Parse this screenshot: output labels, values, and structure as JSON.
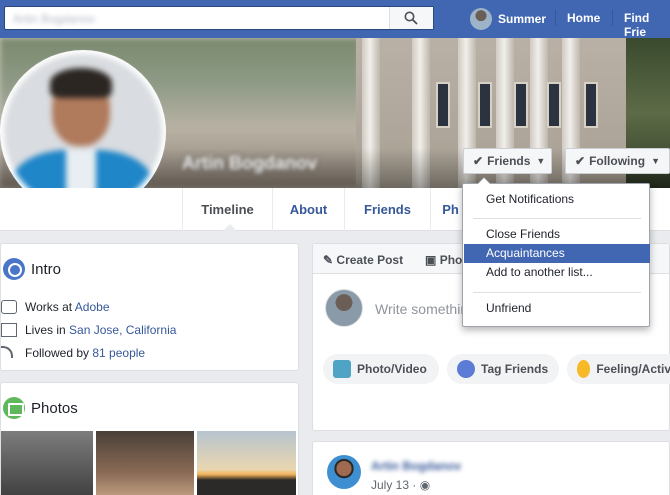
{
  "topbar": {
    "search_placeholder": "Artin Bogdanov",
    "user_name": "Summer",
    "home_label": "Home",
    "find_friends_label": "Find Frie"
  },
  "cover": {
    "profile_name": "Artin Bogdanov",
    "friends_button": "Friends",
    "following_button": "Following"
  },
  "tabs": [
    "Timeline",
    "About",
    "Friends",
    "Ph"
  ],
  "intro": {
    "title": "Intro",
    "works_prefix": "Works at ",
    "works_link": "Adobe",
    "lives_prefix": "Lives in ",
    "lives_link": "San Jose, California",
    "followed_prefix": "Followed by ",
    "followed_link": "81 people"
  },
  "photos": {
    "title": "Photos"
  },
  "composer": {
    "create_post": "Create Post",
    "photo_tab": "Pho",
    "placeholder": "Write somethin",
    "actions": [
      "Photo/Video",
      "Tag Friends",
      "Feeling/Activ"
    ]
  },
  "post": {
    "author": "Artin Bogdanov",
    "date": "July 13 · "
  },
  "dropdown": {
    "items": [
      "Get Notifications",
      "Close Friends",
      "Acquaintances",
      "Add to another list...",
      "Unfriend"
    ],
    "selected": "Acquaintances"
  },
  "colors": {
    "brand_blue": "#4267b2",
    "link_blue": "#365899",
    "selection": "#4267b2"
  }
}
